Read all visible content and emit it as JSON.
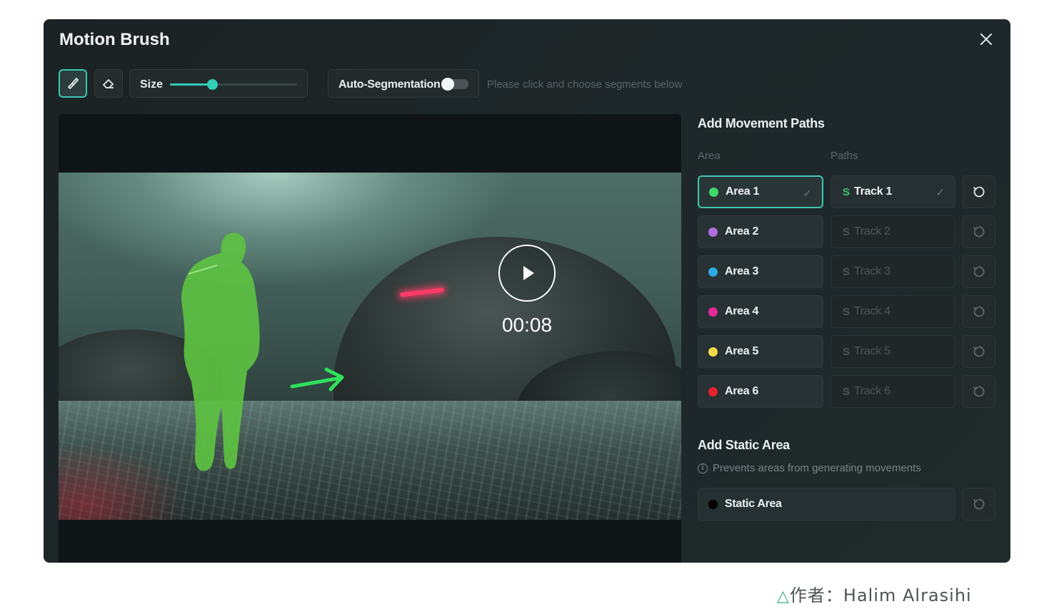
{
  "dialog": {
    "title": "Motion Brush",
    "close_icon": "close-icon"
  },
  "toolbar": {
    "brush_icon": "brush-icon",
    "eraser_icon": "eraser-icon",
    "size_label": "Size",
    "size_value_fraction": 0.33,
    "auto_segmentation_label": "Auto-Segmentation",
    "auto_segmentation_on": false,
    "hint": "Please click and choose segments below"
  },
  "video": {
    "time": "00:08",
    "play_icon": "play-icon"
  },
  "movement": {
    "title": "Add Movement Paths",
    "area_header": "Area",
    "paths_header": "Paths",
    "rows": [
      {
        "area": "Area 1",
        "color": "#3ed96a",
        "track": "Track 1",
        "selected": true
      },
      {
        "area": "Area 2",
        "color": "#b06ee0",
        "track": "Track 2",
        "selected": false
      },
      {
        "area": "Area 3",
        "color": "#2fa9e6",
        "track": "Track 3",
        "selected": false
      },
      {
        "area": "Area 4",
        "color": "#e62a9a",
        "track": "Track 4",
        "selected": false
      },
      {
        "area": "Area 5",
        "color": "#f0dc4a",
        "track": "Track 5",
        "selected": false
      },
      {
        "area": "Area 6",
        "color": "#e8202e",
        "track": "Track 6",
        "selected": false
      }
    ],
    "check_glyph": "✓",
    "track_glyph": "S",
    "reset_icon": "reset-icon"
  },
  "static": {
    "title": "Add Static Area",
    "info": "Prevents areas from generating movements",
    "info_glyph": "i",
    "area_label": "Static Area",
    "area_color": "#000000"
  },
  "credit": {
    "triangle": "△",
    "text": "作者：Halim Alrasihi"
  }
}
